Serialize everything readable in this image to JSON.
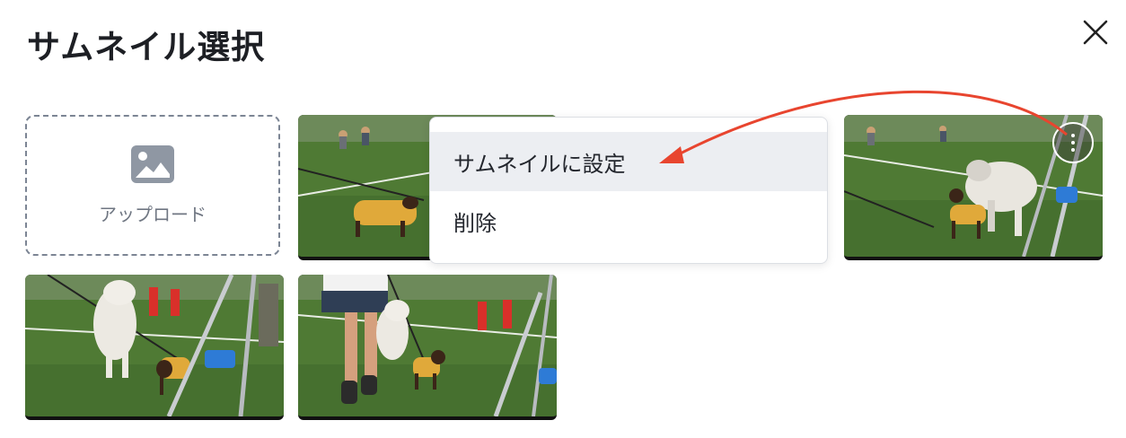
{
  "dialog": {
    "title": "サムネイル選択",
    "close_icon": "close-icon"
  },
  "upload": {
    "label": "アップロード",
    "icon": "image-icon"
  },
  "thumbnails": [
    {
      "name": "thumbnail-1",
      "subject": "dachshund in yellow vest on leash"
    },
    {
      "name": "thumbnail-2",
      "subject": "husky and dachshund near pole"
    },
    {
      "name": "thumbnail-3",
      "subject": "husky and dachshund walking"
    },
    {
      "name": "thumbnail-4",
      "subject": "handler with husky and dachshund"
    }
  ],
  "context_menu": {
    "items": [
      {
        "label": "サムネイルに設定",
        "highlighted": true
      },
      {
        "label": "削除",
        "highlighted": false
      }
    ]
  },
  "colors": {
    "annotation_arrow": "#e8452f",
    "menu_highlight": "#eceef2",
    "grass": "#4f7a34"
  }
}
